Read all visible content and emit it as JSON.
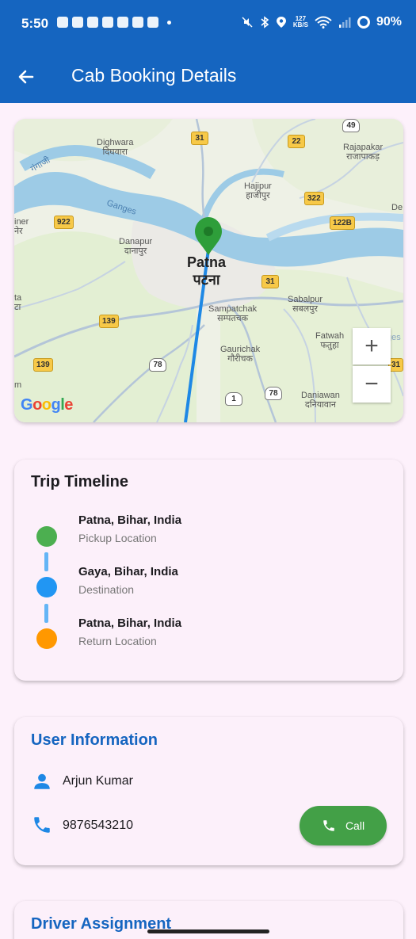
{
  "status_bar": {
    "time": "5:50",
    "network_speed_top": "127",
    "network_speed_unit": "KB/S",
    "battery": "90%"
  },
  "app_bar": {
    "title": "Cab Booking Details",
    "back_icon": "arrow-left-icon"
  },
  "map": {
    "city_en": "Patna",
    "city_hi": "पटना",
    "labels": [
      {
        "en": "Dighwara",
        "hi": "दिघवारा"
      },
      {
        "en": "Hajipur",
        "hi": "हाजीपुर"
      },
      {
        "en": "Rajapakar",
        "hi": "राजापाकड़"
      },
      {
        "en": "Danapur",
        "hi": "दानापुर"
      },
      {
        "en": "Sampatchak",
        "hi": "सम्पतचक"
      },
      {
        "en": "Sabalpur",
        "hi": "सबलपुर"
      },
      {
        "en": "Fatwah",
        "hi": "फतुहा"
      },
      {
        "en": "Gaurichak",
        "hi": "गौरीचक"
      },
      {
        "en": "Daniawan",
        "hi": "दनियावान"
      }
    ],
    "river": "Ganges",
    "river_hi": "गंगाजी",
    "highways": [
      "49",
      "31",
      "22",
      "322",
      "922",
      "122B",
      "31",
      "139",
      "139",
      "78",
      "1",
      "78",
      "31"
    ],
    "edge_labels": [
      "iner",
      "नेर",
      "ta",
      "टा",
      "m",
      "De",
      "ges",
      "31"
    ],
    "zoom_in": "+",
    "zoom_out": "−",
    "attribution": "Google",
    "colors": {
      "route": "#1e88e5",
      "pin": "#2e9e3a",
      "water": "#9dcbe6",
      "land": "#e7f0d8"
    }
  },
  "timeline": {
    "title": "Trip Timeline",
    "items": [
      {
        "title": "Patna, Bihar, India",
        "subtitle": "Pickup Location",
        "color": "#4caf50"
      },
      {
        "title": "Gaya, Bihar, India",
        "subtitle": "Destination",
        "color": "#2196f3"
      },
      {
        "title": "Patna, Bihar, India",
        "subtitle": "Return Location",
        "color": "#ff9800"
      }
    ]
  },
  "user_info": {
    "title": "User Information",
    "name": "Arjun Kumar",
    "phone": "9876543210",
    "call_label": "Call",
    "person_icon": "person-icon",
    "phone_icon": "phone-icon"
  },
  "driver": {
    "title": "Driver Assignment"
  }
}
